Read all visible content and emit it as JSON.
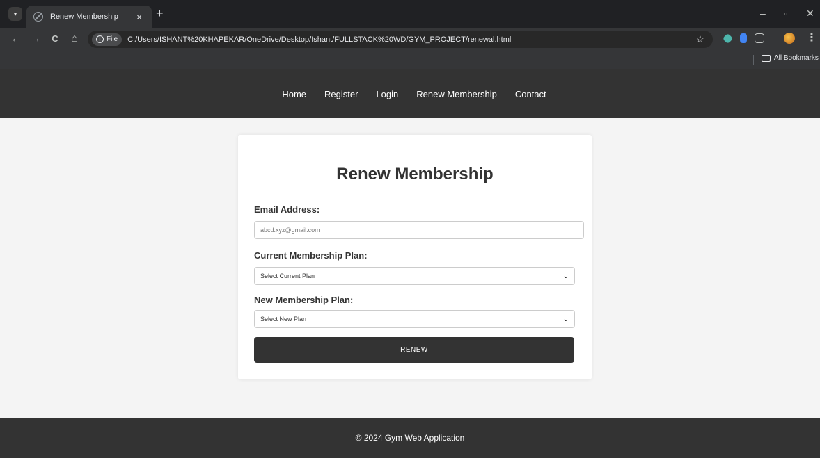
{
  "browser": {
    "tab_title": "Renew Membership",
    "tab_close": "×",
    "new_tab": "+",
    "window_controls": {
      "minimize": "–",
      "restore": "▫",
      "close": "✕"
    },
    "nav": {
      "back": "←",
      "forward": "→",
      "reload": "C",
      "home": "⌂"
    },
    "scheme_chip": "File",
    "url": "C:/Users/ISHANT%20KHAPEKAR/OneDrive/Desktop/Ishant/FULLSTACK%20WD/GYM_PROJECT/renewal.html",
    "bookmarks_label": "All Bookmarks",
    "icons": [
      "tab-search-icon",
      "site-info-icon",
      "star-icon",
      "extensions-icon",
      "profile-icon",
      "menu-icon",
      "folder-icon"
    ]
  },
  "site": {
    "nav": [
      "Home",
      "Register",
      "Login",
      "Renew Membership",
      "Contact"
    ],
    "footer": "© 2024 Gym Web Application"
  },
  "form": {
    "title": "Renew Membership",
    "email_label": "Email Address:",
    "email_placeholder": "abcd.xyz@gmail.com",
    "current_plan_label": "Current Membership Plan:",
    "current_plan_selected": "Select Current Plan",
    "new_plan_label": "New Membership Plan:",
    "new_plan_selected": "Select New Plan",
    "submit_label": "RENEW"
  },
  "colors": {
    "header_bg": "#333333",
    "page_bg": "#f4f4f4",
    "card_bg": "#ffffff",
    "button_bg": "#333333"
  }
}
